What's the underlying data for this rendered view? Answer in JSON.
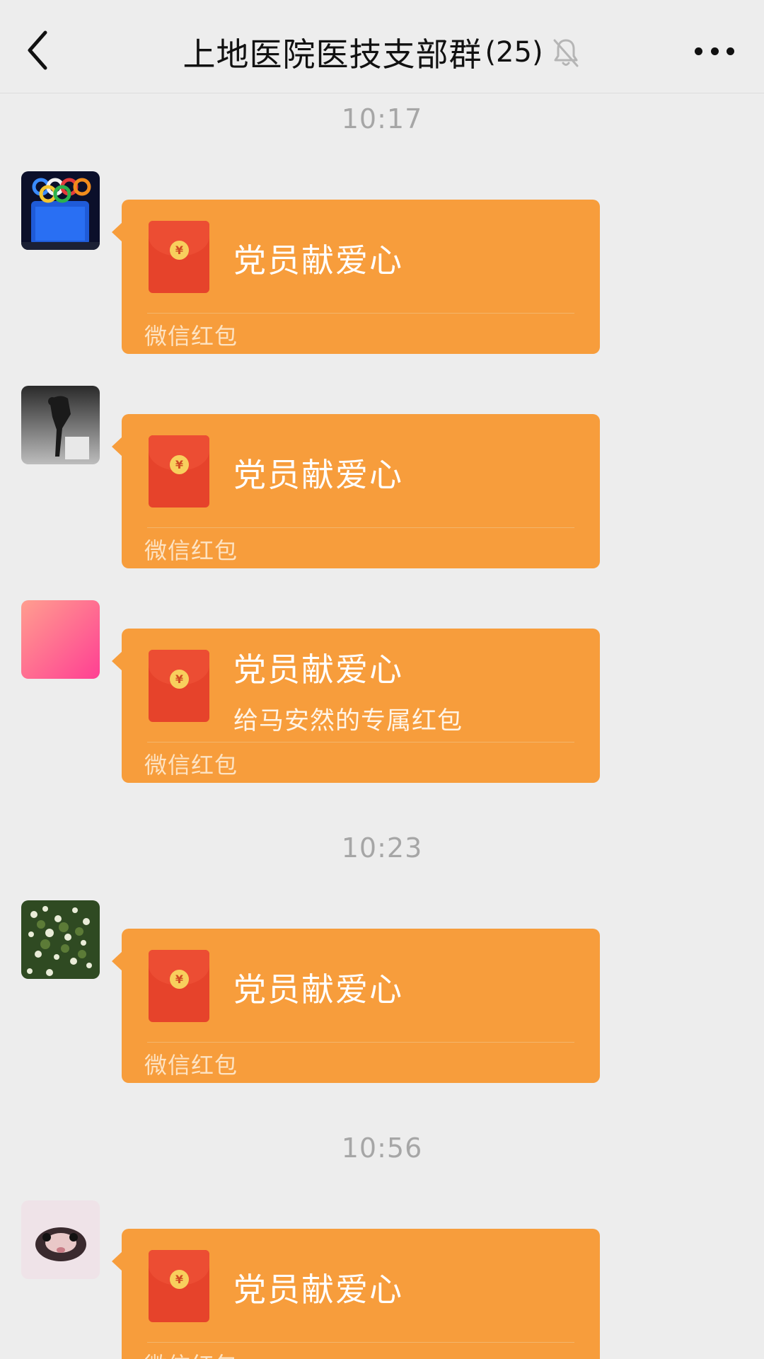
{
  "header": {
    "title": "上地医院医技支部群",
    "member_count": "(25)",
    "back_icon": "chevron-left-icon",
    "mute_icon": "muted-bell-icon",
    "more_icon": "more-dots-icon"
  },
  "timestamps": [
    "10:17",
    "10:23",
    "10:56"
  ],
  "messages": [
    {
      "avatar": "stadium-night-avatar",
      "title": "党员献爱心",
      "subtitle": "",
      "footer": "微信红包"
    },
    {
      "avatar": "dancer-avatar",
      "title": "党员献爱心",
      "subtitle": "",
      "footer": "微信红包"
    },
    {
      "avatar": "pink-gradient-avatar",
      "title": "党员献爱心",
      "subtitle": "给马安然的专属红包",
      "footer": "微信红包"
    },
    {
      "avatar": "flowers-avatar",
      "title": "党员献爱心",
      "subtitle": "",
      "footer": "微信红包"
    },
    {
      "avatar": "pet-avatar",
      "title": "党员献爱心",
      "subtitle": "",
      "footer": "微信红包"
    }
  ],
  "colors": {
    "background": "#ededed",
    "packet": "#f79d3c",
    "envelope": "#e6432b",
    "coin": "#f8cf5d"
  }
}
